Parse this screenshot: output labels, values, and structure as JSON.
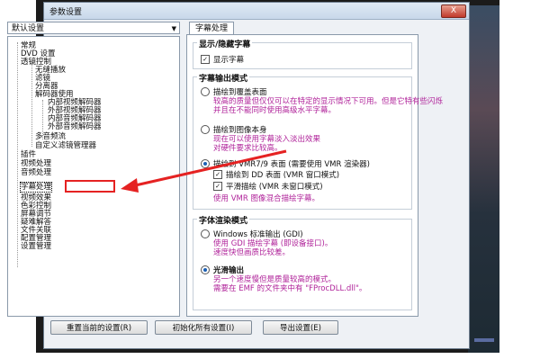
{
  "window": {
    "title": "参数设置",
    "close_label": "X"
  },
  "preset_select": {
    "value": "默认设置"
  },
  "tree": {
    "items": [
      {
        "label": "常规",
        "selected": false
      },
      {
        "label": "DVD 设置",
        "selected": false
      },
      {
        "label": "透镜控制",
        "selected": false
      },
      {
        "label": "无缝播放",
        "selected": false
      },
      {
        "label": "滤镜",
        "selected": false
      },
      {
        "label": "分离器",
        "selected": false
      },
      {
        "label": "解码器使用",
        "selected": false
      },
      {
        "label": "内部视频解码器",
        "selected": false
      },
      {
        "label": "外部视频解码器",
        "selected": false
      },
      {
        "label": "内部音频解码器",
        "selected": false
      },
      {
        "label": "外部音频解码器",
        "selected": false
      },
      {
        "label": "多音频流",
        "selected": false
      },
      {
        "label": "自定义滤镜管理器",
        "selected": false
      },
      {
        "label": "插件",
        "selected": false
      },
      {
        "label": "视频处理",
        "selected": false
      },
      {
        "label": "音频处理",
        "selected": false
      },
      {
        "label": "字幕处理",
        "selected": true
      },
      {
        "label": "视频效果",
        "selected": false
      },
      {
        "label": "色彩控制",
        "selected": false
      },
      {
        "label": "屏幕调节",
        "selected": false
      },
      {
        "label": "疑难解答",
        "selected": false
      },
      {
        "label": "文件关联",
        "selected": false
      },
      {
        "label": "配置管理",
        "selected": false
      },
      {
        "label": "设置管理",
        "selected": false
      }
    ]
  },
  "tab": {
    "label": "字幕处理"
  },
  "show_hide": {
    "title": "显示/隐藏字幕",
    "show_subtitle": {
      "label": "显示字幕",
      "checked": true
    }
  },
  "output_mode": {
    "title": "字幕输出模式",
    "overlay": {
      "label": "描绘到覆盖表面",
      "desc1": "较高的质量但仅仅可以在特定的显示情况下可用。但是它特有些闪烁",
      "desc2": "并且在不能同时使用高级水平字幕。"
    },
    "image": {
      "label": "描绘到图像本身",
      "desc1": "现在可以使用字幕淡入淡出效果",
      "desc2": "对硬件要求比较高。"
    },
    "vmr": {
      "label": "描绘到 VMR7/9 表面 (需要使用 VMR 渲染器)",
      "dd": {
        "label": "描绘到 DD 表面 (VMR 窗口模式)",
        "checked": true
      },
      "flat": {
        "label": "平滑描绘 (VMR 未窗口模式)",
        "checked": true
      },
      "desc": "使用 VMR 图像混合描绘字幕。"
    }
  },
  "render_mode": {
    "title": "字体渲染模式",
    "gdi": {
      "label": "Windows 标准输出 (GDI)",
      "desc1": "使用 GDI 描绘字幕 (即设备接口)。",
      "desc2": "速度快但画质比较差。"
    },
    "smooth": {
      "label": "光滑输出",
      "desc1": "另一个速度慢但是质量较高的模式。",
      "desc2": "需要在 EMF 的文件夹中有 \"FProcDLL.dll\"。"
    }
  },
  "buttons": {
    "reset": "重置当前的设置(R)",
    "init_all": "初始化所有设置(I)",
    "export": "导出设置(E)"
  },
  "colors": {
    "annotation": "#e52222",
    "desc_text": "#b0239a"
  }
}
